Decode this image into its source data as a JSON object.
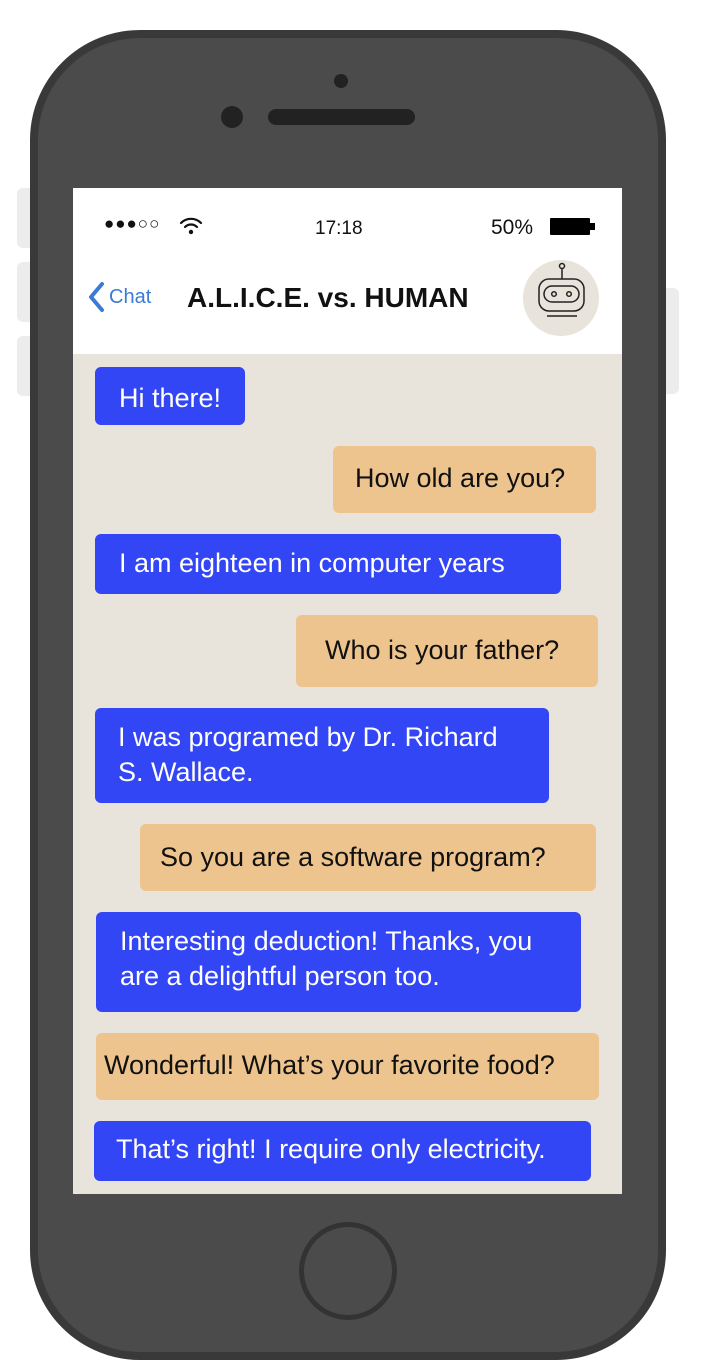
{
  "status_bar": {
    "signal": "●●●○○",
    "time": "17:18",
    "battery": "50%"
  },
  "header": {
    "back_label": "Chat",
    "title": "A.L.I.C.E. vs. HUMAN",
    "avatar_icon": "robot-icon"
  },
  "messages": [
    {
      "sender": "bot",
      "text": "Hi there!"
    },
    {
      "sender": "user",
      "text": "How old are you?"
    },
    {
      "sender": "bot",
      "text": "I am eighteen in computer years"
    },
    {
      "sender": "user",
      "text": "Who is your father?"
    },
    {
      "sender": "bot",
      "lines": [
        "I was programed by Dr. Richard",
        "S. Wallace."
      ]
    },
    {
      "sender": "user",
      "text": "So you are a software program?"
    },
    {
      "sender": "bot",
      "lines": [
        "Interesting deduction! Thanks, you",
        "are a delightful person too."
      ]
    },
    {
      "sender": "user",
      "text": "Wonderful! What’s your favorite food?"
    },
    {
      "sender": "bot",
      "text": "That’s right! I require only electricity."
    }
  ],
  "colors": {
    "bot_bubble": "#3346f5",
    "user_bubble": "#eec48e",
    "chat_background": "#e8e3db",
    "link": "#3a7bd5"
  }
}
